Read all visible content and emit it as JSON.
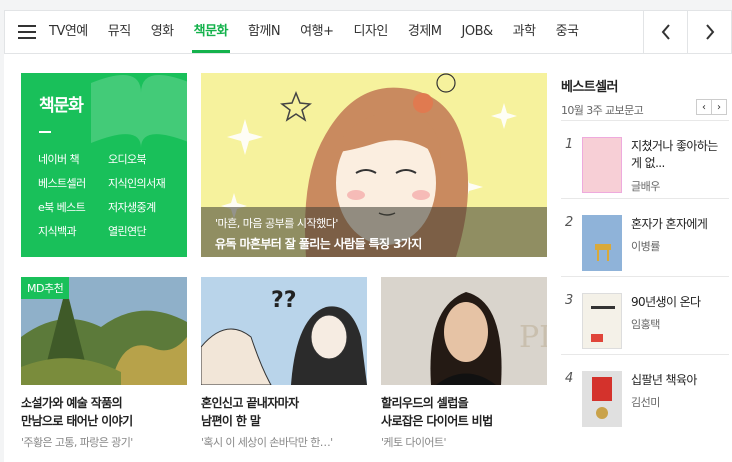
{
  "tabs": [
    "TV연예",
    "뮤직",
    "영화",
    "책문화",
    "함께N",
    "여행+",
    "디자인",
    "경제M",
    "JOB&",
    "과학",
    "중국"
  ],
  "active_tab": "책문화",
  "green_card": {
    "title": "책문화",
    "links": [
      "네이버 책",
      "오디오북",
      "베스트셀러",
      "지식인의서재",
      "e북 베스트",
      "저자생중계",
      "지식백과",
      "열린연단"
    ]
  },
  "feature": {
    "caption_sub": "'마흔, 마음 공부를 시작했다'",
    "caption_title": "유독 마흔부터 잘 풀리는 사람들 특징 3가지"
  },
  "cards": [
    {
      "badge": "MD추천",
      "title": "소설가와 예술 작품의",
      "title2": "만남으로 태어난 이야기",
      "sub": "'주황은 고통, 파랑은 광기'"
    },
    {
      "title": "혼인신고 끝내자마자",
      "title2": "남편이 한 말",
      "sub": "'혹시 이 세상이 손바닥만 한…'"
    },
    {
      "title": "할리우드의 셀럽을",
      "title2": "사로잡은 다이어트 비법",
      "sub": "'케토 다이어트'"
    }
  ],
  "bestseller": {
    "title": "베스트셀러",
    "subtitle": "10월 3주 교보문고",
    "items": [
      {
        "rank": "1",
        "title": "지쳤거나 좋아하는 게 없...",
        "author": "글배우",
        "cover_color": "#f7cfd6"
      },
      {
        "rank": "2",
        "title": "혼자가 혼자에게",
        "author": "이병률",
        "cover_color": "#8fb3d9"
      },
      {
        "rank": "3",
        "title": "90년생이 온다",
        "author": "임홍택",
        "cover_color": "#f4f1e8"
      },
      {
        "rank": "4",
        "title": "십팔년 책육아",
        "author": "김선미",
        "cover_color": "#e0e0e0"
      }
    ]
  }
}
